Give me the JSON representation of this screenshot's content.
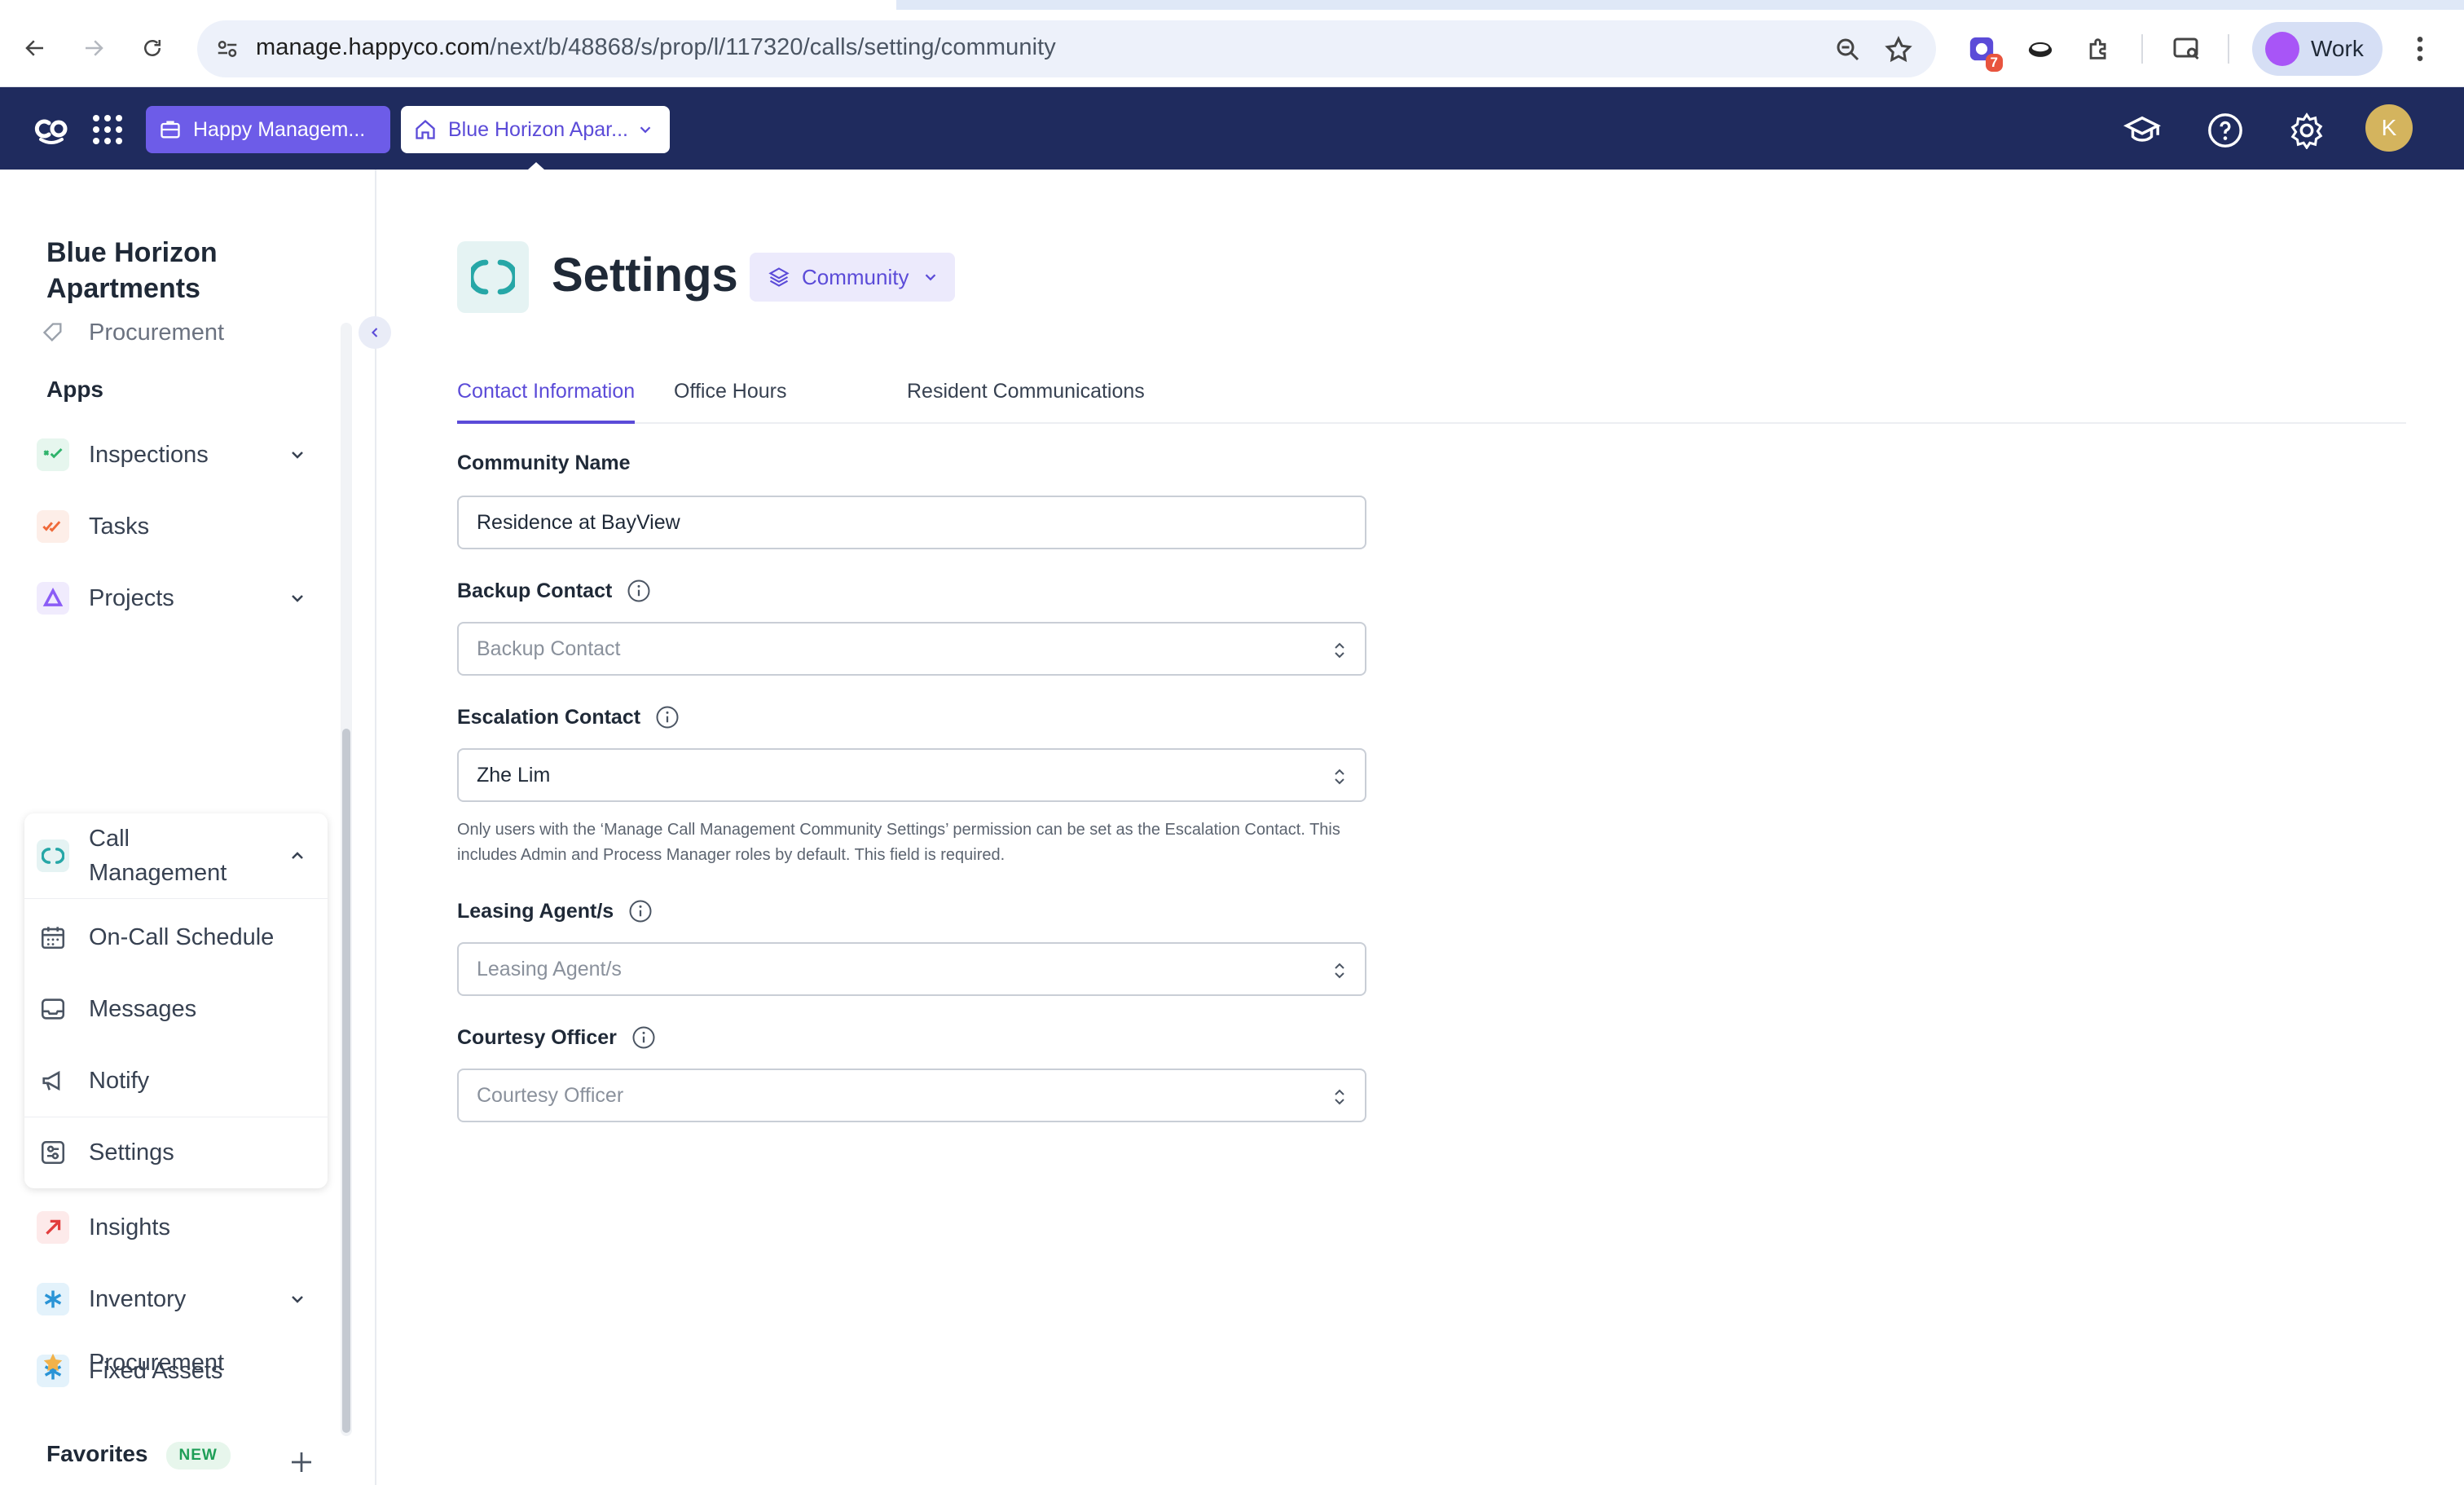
{
  "browser": {
    "url_host": "manage.happyco.com",
    "url_path": "/next/b/48868/s/prop/l/117320/calls/setting/community",
    "extension_badge": "7",
    "profile_label": "Work"
  },
  "header": {
    "org_label": "Happy Managem...",
    "property_label": "Blue Horizon Apar...",
    "avatar_initial": "K"
  },
  "sidebar": {
    "property_name": "Blue Horizon Apartments",
    "partial_item": "Procurement",
    "apps_title": "Apps",
    "items": [
      {
        "label": "Inspections"
      },
      {
        "label": "Tasks"
      },
      {
        "label": "Projects"
      },
      {
        "label": "Call Management"
      },
      {
        "label": "On-Call Schedule"
      },
      {
        "label": "Messages"
      },
      {
        "label": "Notify"
      },
      {
        "label": "Settings"
      },
      {
        "label": "Insights"
      },
      {
        "label": "Inventory"
      },
      {
        "label": "Fixed Assets"
      }
    ],
    "favorites_title": "Favorites",
    "favorites_badge": "NEW",
    "favorites": [
      {
        "label": "Procurement"
      }
    ]
  },
  "main": {
    "title": "Settings",
    "scope_label": "Community",
    "tabs": [
      {
        "label": "Contact Information",
        "active": true
      },
      {
        "label": "Office Hours",
        "active": false
      },
      {
        "label": "Resident Communications",
        "active": false
      }
    ],
    "fields": {
      "community_name": {
        "label": "Community Name",
        "value": "Residence at BayView"
      },
      "backup_contact": {
        "label": "Backup Contact",
        "placeholder": "Backup Contact"
      },
      "escalation_contact": {
        "label": "Escalation Contact",
        "value": "Zhe Lim"
      },
      "escalation_help": "Only users with the ‘Manage Call Management Community Settings’ permission can be set as the Escalation Contact. This includes Admin and Process Manager roles by default. This field is required.",
      "leasing_agents": {
        "label": "Leasing Agent/s",
        "placeholder": "Leasing Agent/s"
      },
      "courtesy_officer": {
        "label": "Courtesy Officer",
        "placeholder": "Courtesy Officer"
      }
    }
  },
  "colors": {
    "appbar": "#1f2b5e",
    "accent": "#5b4bd8",
    "org_button": "#6d5ce8"
  }
}
